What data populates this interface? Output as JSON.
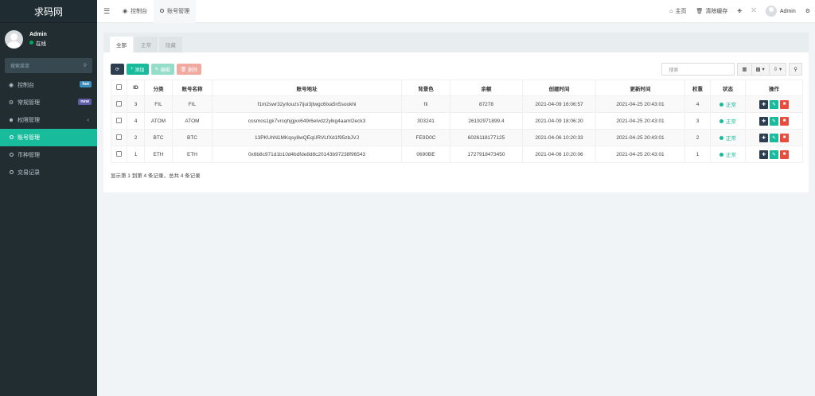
{
  "brand": "求码网",
  "user": {
    "name": "Admin",
    "status": "在线"
  },
  "sidebar": {
    "search_placeholder": "搜索菜单",
    "items": [
      {
        "label": "控制台",
        "icon": "dashboard-icon",
        "badge": "hot"
      },
      {
        "label": "常规管理",
        "icon": "cogs-icon",
        "badge": "new"
      },
      {
        "label": "权限管理",
        "icon": "group-icon"
      },
      {
        "label": "账号管理",
        "icon": "circle-icon"
      },
      {
        "label": "币种管理",
        "icon": "circle-icon"
      },
      {
        "label": "交易记录",
        "icon": "circle-icon"
      }
    ]
  },
  "topbar": {
    "tabs": [
      {
        "label": "控制台",
        "icon": "dashboard-icon"
      },
      {
        "label": "账号管理",
        "icon": "circle-icon"
      }
    ],
    "home": "主页",
    "clear_cache": "清除缓存",
    "user": "Admin"
  },
  "panel": {
    "tabs": [
      "全部",
      "正常",
      "隐藏"
    ],
    "toolbar": {
      "add": "添加",
      "edit": "编辑",
      "delete": "删除"
    },
    "search_placeholder": "搜索"
  },
  "table": {
    "headers": [
      "ID",
      "分类",
      "账号名称",
      "账号地址",
      "背景色",
      "余额",
      "创建时间",
      "更新时间",
      "权重",
      "状态",
      "操作"
    ],
    "rows": [
      {
        "id": "3",
        "cat": "FIL",
        "name": "FIL",
        "addr": "f1m2swr32yrlouzs7ijui3jtwgc6lxa5n5sookhi",
        "bg": "fil",
        "balance": "87278",
        "created": "2021-04-09 16:06:57",
        "updated": "2021-04-25 20:43:01",
        "weight": "4",
        "status": "正常"
      },
      {
        "id": "4",
        "cat": "ATOM",
        "name": "ATOM",
        "addr": "cosmos1gk7vrcqhjgjxx649r6elvdz2ylkg4aaml2eck3",
        "bg": "303241",
        "balance": "26192971899.4",
        "created": "2021-04-09 18:06:20",
        "updated": "2021-04-25 20:43:01",
        "weight": "3",
        "status": "正常"
      },
      {
        "id": "2",
        "cat": "BTC",
        "name": "BTC",
        "addr": "13PKUhN1MKqsy8wQEqURVLfXd1f95zbJVJ",
        "bg": "FE9D0C",
        "balance": "6026118177125",
        "created": "2021-04-06 10:20:33",
        "updated": "2021-04-25 20:43:01",
        "weight": "2",
        "status": "正常"
      },
      {
        "id": "1",
        "cat": "ETH",
        "name": "ETH",
        "addr": "0x6b8c971d1b10d4bdfde8d8c20143b97238f96543",
        "bg": "0690BE",
        "balance": "1727918473450",
        "created": "2021-04-06 10:20:06",
        "updated": "2021-04-25 20:43:01",
        "weight": "1",
        "status": "正常"
      }
    ]
  },
  "pagination_info": "显示第 1 到第 4 条记录，总共 4 条记录",
  "colors": {
    "sidebar": "#222d32",
    "accent": "#18bc9c",
    "danger": "#e74c3c",
    "dark": "#2c3e50"
  }
}
